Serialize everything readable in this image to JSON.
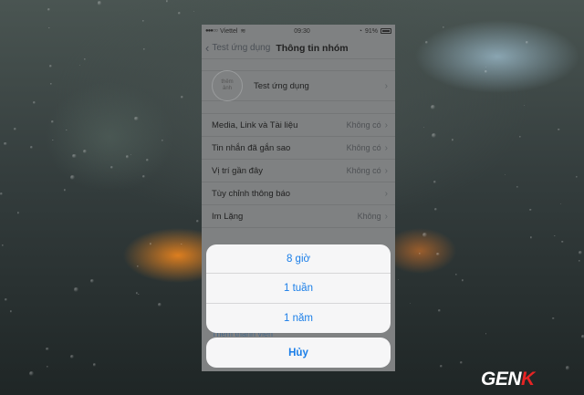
{
  "status_bar": {
    "carrier": "Viettel",
    "time": "09:30",
    "battery": "91%"
  },
  "nav": {
    "back_label": "Test ứng dụng",
    "title": "Thông tin nhóm"
  },
  "group": {
    "avatar_text": "thêm ảnh",
    "name": "Test ứng dụng"
  },
  "rows": [
    {
      "label": "Media, Link và Tài liệu",
      "value": "Không có"
    },
    {
      "label": "Tin nhắn đã gắn sao",
      "value": "Không có"
    },
    {
      "label": "Vị trí gần đây",
      "value": "Không có"
    },
    {
      "label": "Tùy chỉnh thông báo",
      "value": ""
    },
    {
      "label": "Im Lặng",
      "value": "Không"
    }
  ],
  "partial_row": "Thêm thành viên",
  "action_sheet": {
    "options": [
      "8 giờ",
      "1 tuần",
      "1 năm"
    ],
    "cancel": "Hủy"
  },
  "watermark": {
    "part1": "GEN",
    "part2": "K"
  }
}
